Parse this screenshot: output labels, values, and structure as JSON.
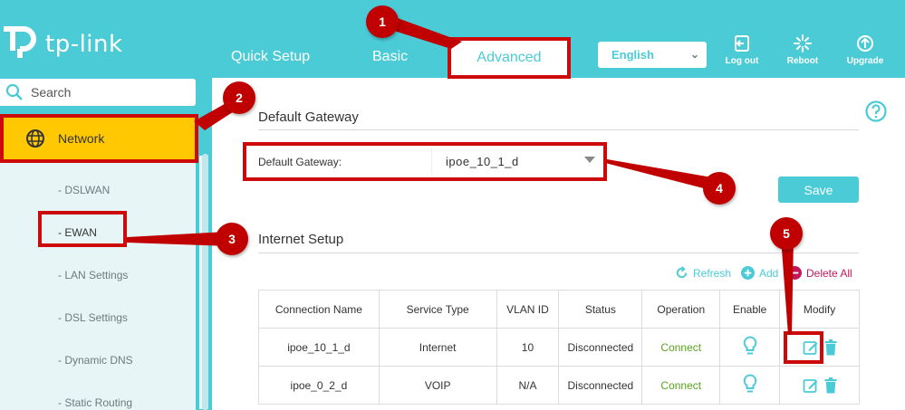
{
  "brand": {
    "name": "tp-link"
  },
  "nav": {
    "tabs": [
      "Quick Setup",
      "Basic",
      "Advanced"
    ]
  },
  "language": {
    "selected": "English"
  },
  "tools": {
    "logout": "Log out",
    "reboot": "Reboot",
    "upgrade": "Upgrade"
  },
  "sidebar": {
    "search_placeholder": "Search",
    "section": "Network",
    "items": [
      "- DSLWAN",
      "- EWAN",
      "- LAN Settings",
      "- DSL Settings",
      "- Dynamic DNS",
      "- Static Routing"
    ]
  },
  "gateway": {
    "title": "Default Gateway",
    "label": "Default Gateway:",
    "value": "ipoe_10_1_d",
    "save": "Save"
  },
  "internet": {
    "title": "Internet Setup",
    "refresh": "Refresh",
    "add": "Add",
    "delete_all": "Delete All",
    "columns": [
      "Connection Name",
      "Service Type",
      "VLAN ID",
      "Status",
      "Operation",
      "Enable",
      "Modify"
    ],
    "rows": [
      {
        "name": "ipoe_10_1_d",
        "type": "Internet",
        "vlan": "10",
        "status": "Disconnected",
        "operation": "Connect"
      },
      {
        "name": "ipoe_0_2_d",
        "type": "VOIP",
        "vlan": "N/A",
        "status": "Disconnected",
        "operation": "Connect"
      }
    ]
  },
  "annotations": [
    "1",
    "2",
    "3",
    "4",
    "5"
  ],
  "colors": {
    "accent": "#4acbd6",
    "highlight": "#ffc800",
    "annotation": "#cc0a0a",
    "connect": "#57a51b",
    "delete": "#c2185b"
  }
}
